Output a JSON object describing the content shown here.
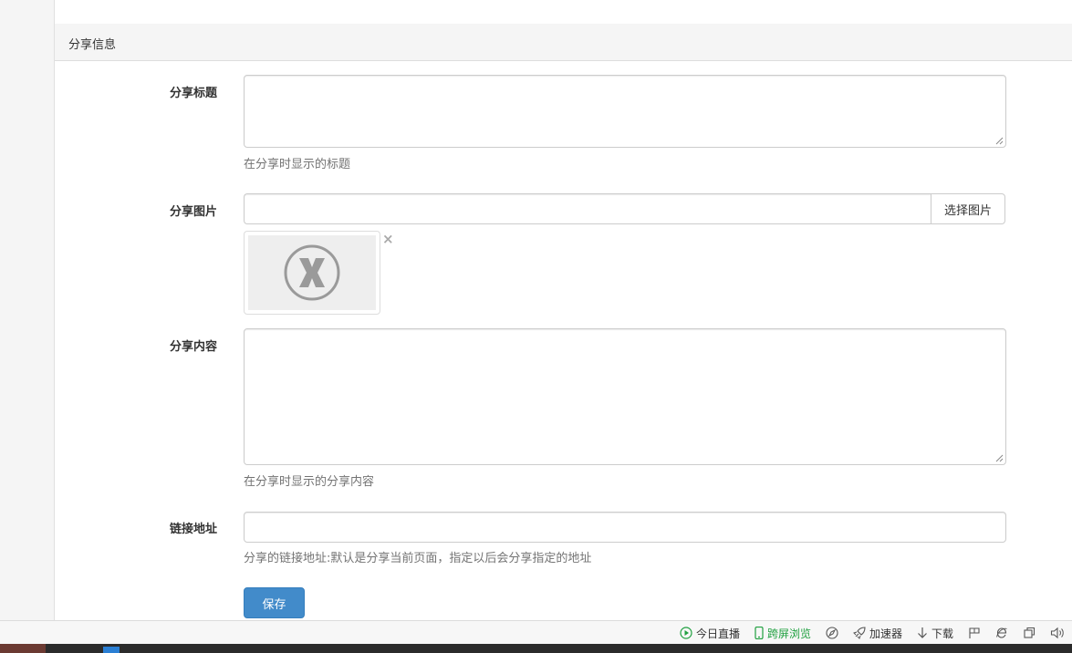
{
  "panel": {
    "heading": "分享信息"
  },
  "form": {
    "title_field": {
      "label": "分享标题",
      "value": "",
      "help": "在分享时显示的标题"
    },
    "image_field": {
      "label": "分享图片",
      "value": "",
      "button": "选择图片",
      "remove_glyph": "×"
    },
    "content_field": {
      "label": "分享内容",
      "value": "",
      "help": "在分享时显示的分享内容"
    },
    "link_field": {
      "label": "链接地址",
      "value": "",
      "help": "分享的链接地址:默认是分享当前页面，指定以后会分享指定的地址"
    },
    "save_label": "保存"
  },
  "status_bar": {
    "items": [
      {
        "label": "今日直播",
        "icon": "play-circle-icon"
      },
      {
        "label": "跨屏浏览",
        "icon": "phone-icon",
        "color": "#20a040"
      },
      {
        "label": "",
        "icon": "compass-icon"
      },
      {
        "label": "加速器",
        "icon": "rocket-icon"
      },
      {
        "label": "下载",
        "icon": "download-arrow-icon"
      },
      {
        "label": "",
        "icon": "flag-icon"
      },
      {
        "label": "",
        "icon": "ie-icon"
      },
      {
        "label": "",
        "icon": "window-icon"
      },
      {
        "label": "",
        "icon": "speaker-icon"
      }
    ]
  },
  "colors": {
    "primary": "#428bca",
    "border": "#cccccc",
    "help_text": "#737373",
    "panel_bg": "#f5f5f5"
  }
}
